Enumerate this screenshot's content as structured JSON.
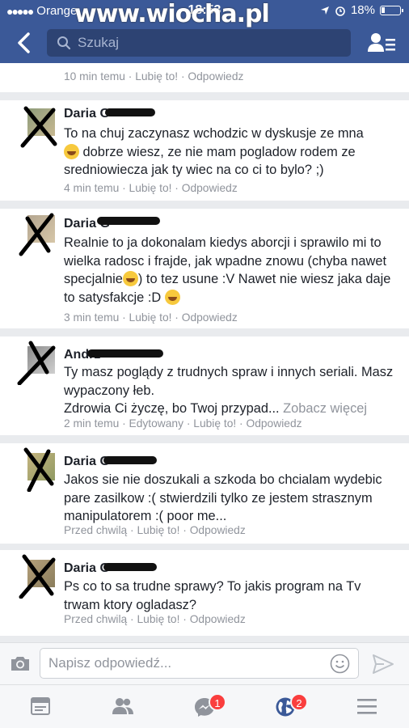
{
  "status_bar": {
    "carrier": "Orange",
    "time": "18:53",
    "battery": "18%"
  },
  "watermark": "www.wiocha.pl",
  "header": {
    "search_placeholder": "Szukaj"
  },
  "comments": [
    {
      "author": "",
      "text": "",
      "time": "10 min temu",
      "like": "Lubię to!",
      "reply": "Odpowiedz"
    },
    {
      "author": "Daria G",
      "text_before_emoji": "To na chuj zaczynasz wchodzic w dyskusje ze mna",
      "text_after_emoji": " dobrze wiesz, ze nie mam pogladow rodem ze sredniowiecza jak ty wiec na co ci to bylo? ;)",
      "time": "4 min temu",
      "like": "Lubię to!",
      "reply": "Odpowiedz"
    },
    {
      "author": "Daria G",
      "text_part1": "Realnie to ja dokonalam kiedys aborcji i sprawilo mi to wielka radosc i frajde,  jak wpadne znowu (chyba nawet specjalnie",
      "text_part2": ") to tez usune :V Nawet nie wiesz jaka daje to satysfakcje :D ",
      "time": "3 min temu",
      "like": "Lubię to!",
      "reply": "Odpowiedz"
    },
    {
      "author": "Andrz",
      "text": "Ty masz poglądy z trudnych spraw i innych seriali. Masz wypaczony łeb.\nZdrowia Ci życzę, bo Twoj przypad...",
      "see_more": "Zobacz więcej",
      "time": "2 min temu",
      "edited": "Edytowany",
      "like": "Lubię to!",
      "reply": "Odpowiedz"
    },
    {
      "author": "Daria G",
      "text": "Jakos sie nie doszukali a szkoda bo chcialam wydebic pare zasilkow :( stwierdzili tylko ze jestem strasznym manipulatorem :( poor me...",
      "time": "Przed chwilą",
      "like": "Lubię to!",
      "reply": "Odpowiedz"
    },
    {
      "author": "Daria G",
      "text": "Ps co to sa trudne sprawy? To jakis program na Tv trwam ktory ogladasz?",
      "time": "Przed chwilą",
      "like": "Lubię to!",
      "reply": "Odpowiedz"
    }
  ],
  "reply_bar": {
    "placeholder": "Napisz odpowiedź..."
  },
  "tabs": [
    {
      "name": "news-feed",
      "badge": ""
    },
    {
      "name": "friends",
      "badge": ""
    },
    {
      "name": "messenger",
      "badge": "1"
    },
    {
      "name": "notifications",
      "badge": "2"
    },
    {
      "name": "menu",
      "badge": ""
    }
  ],
  "colors": {
    "brand": "#3b5998",
    "badge": "#fa3e3e",
    "meta_text": "#90949c"
  }
}
